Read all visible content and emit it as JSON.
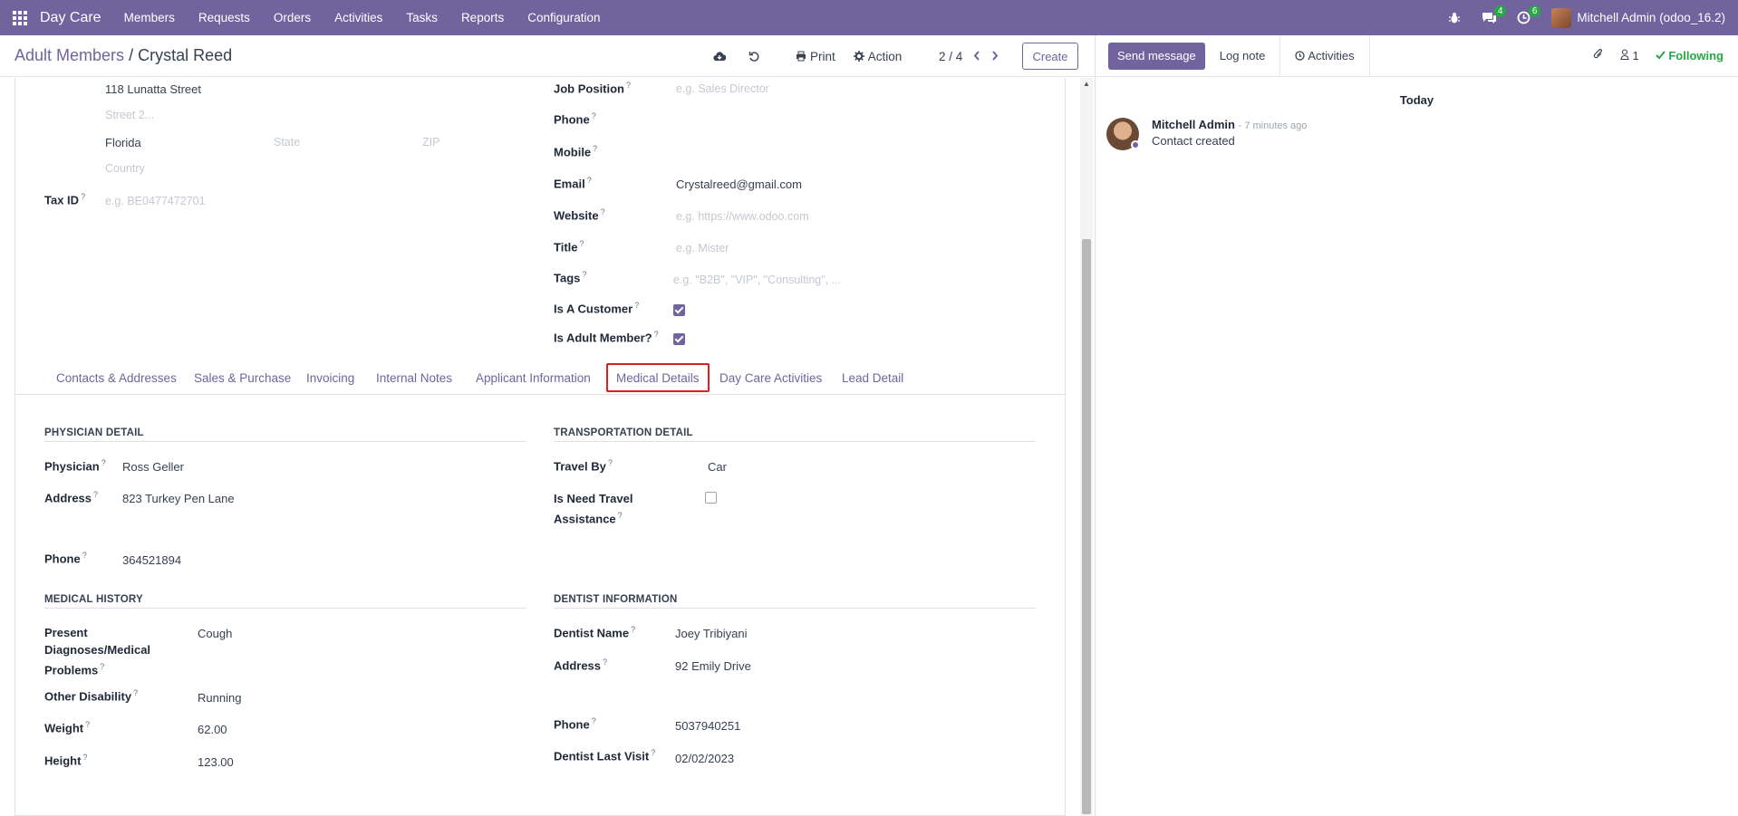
{
  "topnav": {
    "app_name": "Day Care",
    "menu": [
      "Members",
      "Requests",
      "Orders",
      "Activities",
      "Tasks",
      "Reports",
      "Configuration"
    ],
    "messages_count": "4",
    "activities_count": "6",
    "user": "Mitchell Admin (odoo_16.2)",
    "brand_color": "#71639e"
  },
  "control_panel": {
    "breadcrumb_parent": "Adult Members",
    "breadcrumb_sep": "/",
    "breadcrumb_current": "Crystal Reed",
    "print_label": "Print",
    "action_label": "Action",
    "pager": "2 / 4",
    "create_label": "Create"
  },
  "chatter": {
    "send_message": "Send message",
    "log_note": "Log note",
    "activities": "Activities",
    "followers_count": "1",
    "following": "Following",
    "date_separator": "Today",
    "message": {
      "author": "Mitchell Admin",
      "time": "- 7 minutes ago",
      "text": "Contact created"
    }
  },
  "address": {
    "street": "118 Lunatta Street",
    "street2_placeholder": "Street 2...",
    "city": "Florida",
    "state_placeholder": "State",
    "zip_placeholder": "ZIP",
    "country_placeholder": "Country",
    "tax_id_label": "Tax ID",
    "tax_id_placeholder": "e.g. BE0477472701"
  },
  "contact": {
    "job_position_label": "Job Position",
    "job_position_placeholder": "e.g. Sales Director",
    "phone_label": "Phone",
    "mobile_label": "Mobile",
    "email_label": "Email",
    "email_value": "Crystalreed@gmail.com",
    "website_label": "Website",
    "website_placeholder": "e.g. https://www.odoo.com",
    "title_label": "Title",
    "title_placeholder": "e.g. Mister",
    "tags_label": "Tags",
    "tags_placeholder": "e.g. \"B2B\", \"VIP\", \"Consulting\", ...",
    "is_customer_label": "Is A Customer",
    "is_customer": true,
    "is_adult_member_label": "Is Adult Member?",
    "is_adult_member": true
  },
  "tabs": [
    "Contacts & Addresses",
    "Sales & Purchase",
    "Invoicing",
    "Internal Notes",
    "Applicant Information",
    "Medical Details",
    "Day Care Activities",
    "Lead Detail"
  ],
  "active_tab": "Medical Details",
  "physician": {
    "section": "PHYSICIAN DETAIL",
    "physician_label": "Physician",
    "physician_value": "Ross Geller",
    "address_label": "Address",
    "address_value": "823 Turkey Pen Lane",
    "phone_label": "Phone",
    "phone_value": "364521894"
  },
  "transport": {
    "section": "TRANSPORTATION DETAIL",
    "travel_by_label": "Travel By",
    "travel_by_value": "Car",
    "need_assist_label_1": "Is Need Travel",
    "need_assist_label_2": "Assistance",
    "need_assist": false
  },
  "medical_history": {
    "section": "MEDICAL HISTORY",
    "diagnoses_label_1": "Present",
    "diagnoses_label_2": "Diagnoses/Medical",
    "diagnoses_label_3": "Problems",
    "diagnoses_value": "Cough",
    "disability_label": "Other Disability",
    "disability_value": "Running",
    "weight_label": "Weight",
    "weight_value": "62.00",
    "height_label": "Height",
    "height_value": "123.00"
  },
  "dentist": {
    "section": "DENTIST INFORMATION",
    "name_label": "Dentist Name",
    "name_value": "Joey Tribiyani",
    "address_label": "Address",
    "address_value": "92 Emily Drive",
    "phone_label": "Phone",
    "phone_value": "5037940251",
    "last_visit_label": "Dentist Last Visit",
    "last_visit_value": "02/02/2023"
  }
}
